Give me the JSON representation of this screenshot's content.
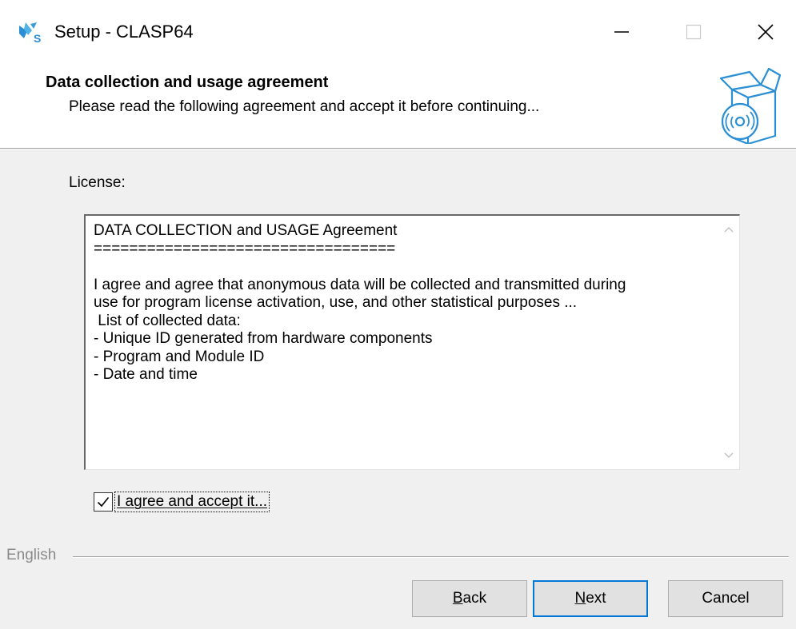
{
  "window": {
    "title": "Setup - CLASP64",
    "icons": {
      "app": "app-logo-icon",
      "minimize": "minimize-icon",
      "maximize": "maximize-icon",
      "close": "close-icon"
    }
  },
  "header": {
    "title": "Data collection and usage agreement",
    "subtitle": "Please read the following agreement and accept it before continuing...",
    "icon": "software-box-icon"
  },
  "license": {
    "label": "License:",
    "text": "DATA COLLECTION and USAGE Agreement\n==================================\n\nI agree and agree that anonymous data will be collected and transmitted during\nuse for program license activation, use, and other statistical purposes ...\n List of collected data:\n- Unique ID generated from hardware components\n- Program and Module ID\n- Date and time"
  },
  "agree": {
    "label": "I agree and accept it...",
    "checked": true
  },
  "language": {
    "label": "English"
  },
  "buttons": {
    "back": {
      "mnemonic": "B",
      "rest": "ack"
    },
    "next": {
      "mnemonic": "N",
      "rest": "ext"
    },
    "cancel": "Cancel"
  },
  "colors": {
    "accent": "#0078d7",
    "icon_blue": "#2a8fd4"
  }
}
